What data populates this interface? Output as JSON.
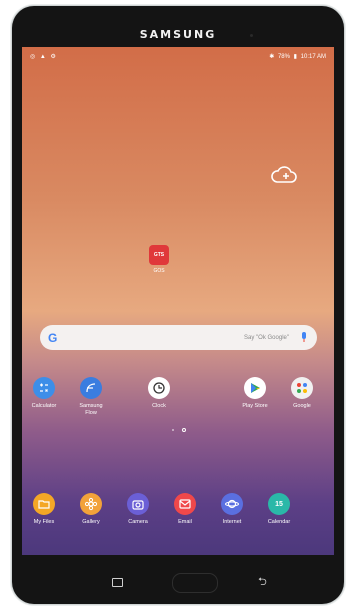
{
  "device": {
    "brand": "SAMSUNG"
  },
  "status_bar": {
    "left_icons": [
      "notification-icon",
      "alert-icon",
      "settings-icon"
    ],
    "battery": "78%",
    "time": "10:17 AM"
  },
  "desktop_app": {
    "label": "GOS",
    "icon_text": "GTS"
  },
  "search": {
    "logo": "G",
    "hint": "Say \"Ok Google\""
  },
  "apps_row1": [
    {
      "label": "Calculator",
      "color": "#3d8ee8"
    },
    {
      "label": "Samsung Flow",
      "color": "#3a7de0"
    },
    {
      "label": "Clock",
      "color": "#ffffff"
    },
    {
      "label": "Play Store",
      "color": "#ffffff"
    },
    {
      "label": "Google",
      "color": "#f1f1f1"
    }
  ],
  "dock": [
    {
      "label": "My Files",
      "color": "#f4a726"
    },
    {
      "label": "Gallery",
      "color": "#f2a23a"
    },
    {
      "label": "Camera",
      "color": "#6b5fd6"
    },
    {
      "label": "Email",
      "color": "#f0484a"
    },
    {
      "label": "Internet",
      "color": "#5a6fe0"
    },
    {
      "label": "Calendar",
      "color": "#2ab8a8",
      "day": "15"
    }
  ],
  "accent": "#e0383a"
}
